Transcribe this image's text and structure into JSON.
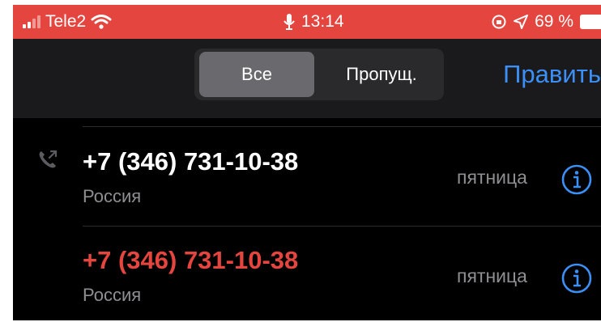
{
  "status_bar": {
    "carrier": "Tele2",
    "time": "13:14",
    "battery_percent": "69 %",
    "icons": [
      "signal-icon",
      "wifi-icon",
      "microphone-icon",
      "orientation-lock-icon",
      "location-arrow-icon",
      "battery-icon"
    ]
  },
  "nav": {
    "segments": [
      {
        "label": "Все",
        "selected": true
      },
      {
        "label": "Пропущ.",
        "selected": false
      }
    ],
    "edit_label": "Править"
  },
  "calls": [
    {
      "number": "+7 (346) 731-10-38",
      "location": "Россия",
      "day": "пятница",
      "missed": false,
      "outgoing_icon": true
    },
    {
      "number": "+7 (346) 731-10-38",
      "location": "Россия",
      "day": "пятница",
      "missed": true,
      "outgoing_icon": false
    }
  ],
  "colors": {
    "status_bar": "#e4463f",
    "missed": "#e4463f",
    "accent": "#3b8ff6",
    "background": "#000000"
  }
}
